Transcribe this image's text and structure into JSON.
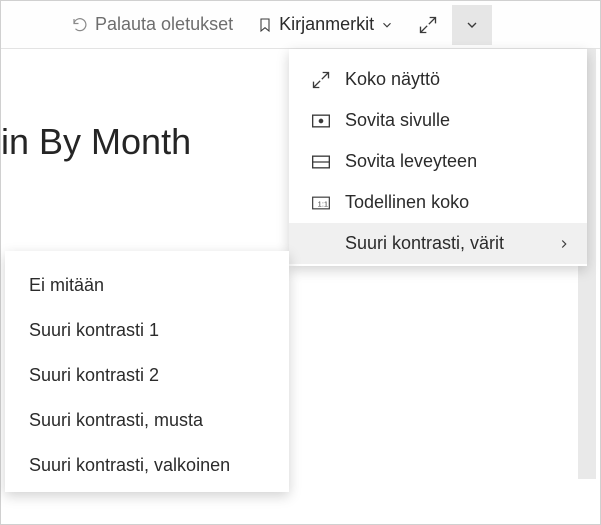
{
  "toolbar": {
    "restore_label": "Palauta oletukset",
    "bookmarks_label": "Kirjanmerkit"
  },
  "page": {
    "title_fragment": "in By Month"
  },
  "view_menu": {
    "fullscreen": "Koko näyttö",
    "fit_page": "Sovita sivulle",
    "fit_width": "Sovita leveyteen",
    "actual_size": "Todellinen koko",
    "high_contrast": "Suuri kontrasti, värit"
  },
  "contrast_submenu": {
    "none": "Ei mitään",
    "hc1": "Suuri kontrasti 1",
    "hc2": "Suuri kontrasti 2",
    "hc_black": "Suuri kontrasti, musta",
    "hc_white": "Suuri kontrasti, valkoinen"
  }
}
